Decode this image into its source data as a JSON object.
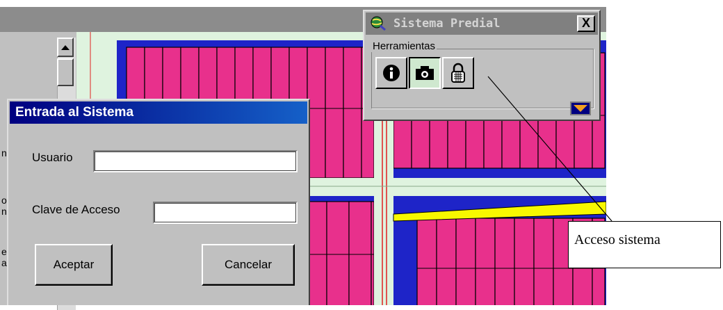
{
  "login_dialog": {
    "title": "Entrada al Sistema",
    "usuario_label": "Usuario",
    "usuario_value": "",
    "clave_label": "Clave de Acceso",
    "clave_value": "",
    "accept_label": "Aceptar",
    "cancel_label": "Cancelar"
  },
  "toolbox": {
    "title": "Sistema Predial",
    "close_label": "X",
    "group_label": "Herramientas",
    "tools": [
      {
        "icon": "info-icon",
        "pressed": false
      },
      {
        "icon": "camera-icon",
        "pressed": true
      },
      {
        "icon": "lock-icon",
        "pressed": false
      }
    ],
    "expand_icon": "chevron-down-icon"
  },
  "side_panel": {
    "clipped_letters": [
      "n",
      "o",
      "n",
      "e",
      "a"
    ]
  },
  "callout": {
    "text": "Acceso sistema"
  },
  "colors": {
    "parcel": "#e8308c",
    "block": "#1e24c8",
    "street": "#dff3df",
    "highlight": "#f8f800",
    "road_line": "#e02020",
    "dialog_title": "#000080",
    "toolbox_title": "#808080"
  }
}
